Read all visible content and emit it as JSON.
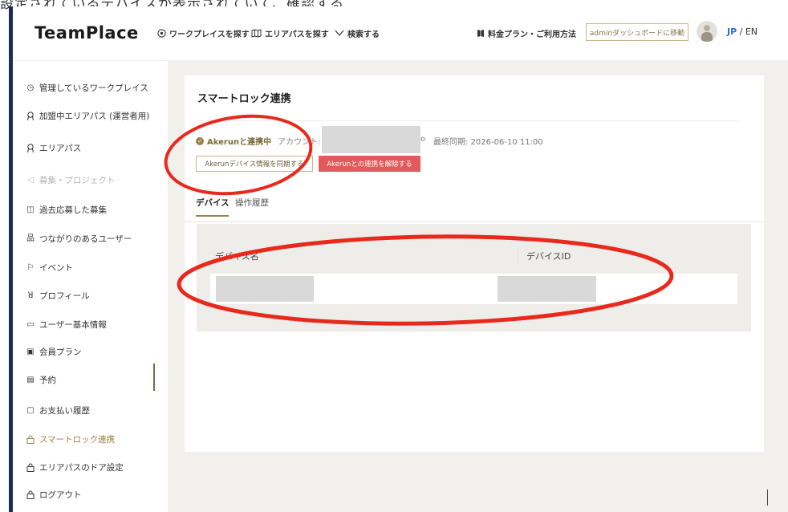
{
  "caption": "設定されているデバイスが表示されていて、確認する",
  "header": {
    "logo": "TeamPlace",
    "nav": [
      {
        "label": "ワークプレイスを探す",
        "icon": "location-pin-icon"
      },
      {
        "label": "エリアパスを探す",
        "icon": "map-icon"
      },
      {
        "label": "検索する",
        "icon": "chevron-down-icon"
      }
    ],
    "plan_link": "料金プラン・ご利用方法",
    "admin_button": "adminダッシュボードに移動",
    "lang_current": "JP",
    "lang_separator": " / ",
    "lang_other": "EN"
  },
  "sidebar": {
    "items": [
      {
        "label": "管理しているワークプレイス",
        "icon": "clock-icon",
        "state": "normal"
      },
      {
        "label": "加盟中エリアパス (運営者用)",
        "icon": "ribbon-icon",
        "state": "normal"
      },
      {
        "label": "エリアパス",
        "icon": "ribbon-icon",
        "state": "normal"
      },
      {
        "label": "募集・プロジェクト",
        "icon": "megaphone-icon",
        "state": "disabled"
      },
      {
        "label": "過去応募した募集",
        "icon": "archive-icon",
        "state": "normal"
      },
      {
        "label": "つながりのあるユーザー",
        "icon": "network-icon",
        "state": "normal"
      },
      {
        "label": "イベント",
        "icon": "flag-icon",
        "state": "normal"
      },
      {
        "label": "プロフィール",
        "icon": "person-icon",
        "state": "normal"
      },
      {
        "label": "ユーザー基本情報",
        "icon": "id-card-icon",
        "state": "normal"
      },
      {
        "label": "会員プラン",
        "icon": "plan-icon",
        "state": "normal"
      },
      {
        "label": "予約",
        "icon": "calendar-icon",
        "state": "normal"
      },
      {
        "label": "お支払い履歴",
        "icon": "receipt-icon",
        "state": "normal"
      },
      {
        "label": "スマートロック連携",
        "icon": "lock-icon",
        "state": "active"
      },
      {
        "label": "エリアパスのドア設定",
        "icon": "lock-icon",
        "state": "normal"
      },
      {
        "label": "ログアウト",
        "icon": "lock-icon",
        "state": "normal"
      }
    ]
  },
  "main": {
    "title": "スマートロック連携",
    "status_label": "Akerunと連携中",
    "account_label": "アカウント:",
    "account_tail": "o",
    "last_sync": "最終同期: 2026-06-10 11:00",
    "sync_button": "Akerunデバイス情報を同期する",
    "unlink_button": "Akerunとの連携を解除する",
    "tabs": [
      {
        "label": "デバイス",
        "active": true
      },
      {
        "label": "操作履歴",
        "active": false
      }
    ],
    "table": {
      "columns": [
        "デバイス名",
        "デバイスID"
      ]
    }
  },
  "colors": {
    "accent": "#9a8248",
    "danger": "#e25a5a",
    "annotation": "#e8291c",
    "sidebar_bar": "#1f2e4f"
  }
}
